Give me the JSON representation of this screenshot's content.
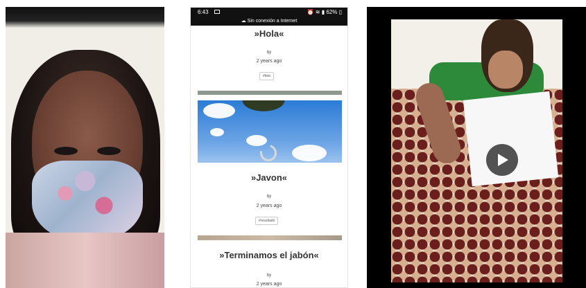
{
  "phone": {
    "status": {
      "time": "6:43",
      "battery": "62%"
    },
    "offline_banner": "Sin conexión a Internet",
    "posts": [
      {
        "title": "»Hola«",
        "by": "by",
        "ago": "2 years ago",
        "tag": "#foto"
      },
      {
        "title": "»Javon«",
        "by": "by",
        "ago": "2 years ago",
        "tag": "#resultado"
      },
      {
        "title": "»Terminamos el jabón«",
        "by": "by",
        "ago": "2 years ago"
      }
    ]
  },
  "icons": {
    "gallery": "image-icon",
    "status": [
      "alarm-icon",
      "wifi-icon",
      "signal-icon",
      "battery-icon"
    ],
    "cloud": "cloud-off-icon",
    "play": "play-icon"
  },
  "colors": {
    "status_bar": "#111111",
    "title_text": "#333333",
    "video_bg": "#000000",
    "play_button": "#4a4a4a"
  }
}
